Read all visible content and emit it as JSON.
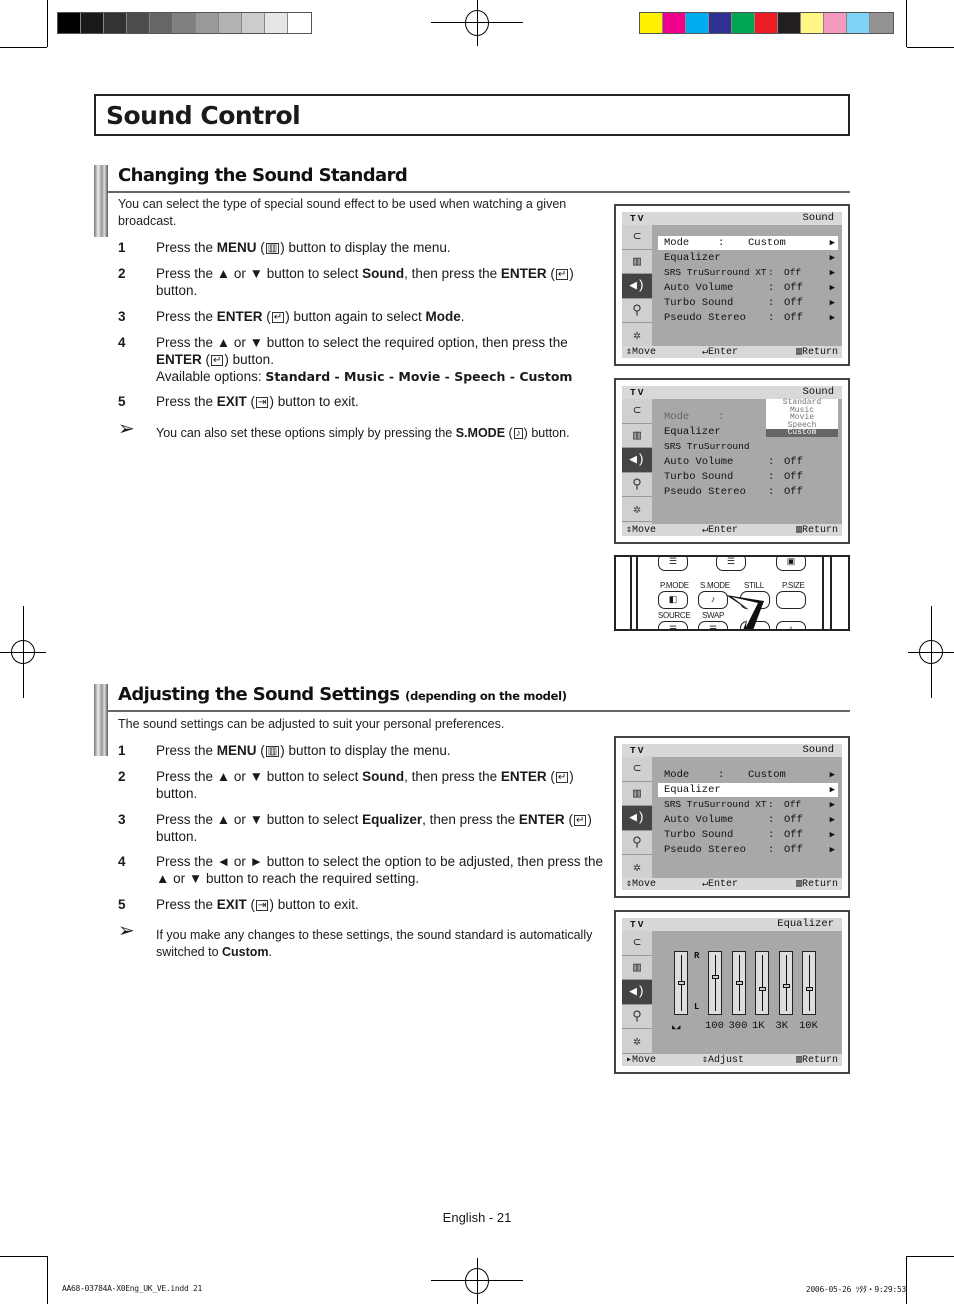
{
  "print_marks": {
    "gray_swatches": [
      "#000000",
      "#1a1a1a",
      "#333333",
      "#4d4d4d",
      "#666666",
      "#808080",
      "#999999",
      "#b3b3b3",
      "#cccccc",
      "#e6e6e6",
      "#ffffff"
    ],
    "color_swatches": [
      "#fff200",
      "#ec008c",
      "#00aeef",
      "#2e3192",
      "#00a651",
      "#ed1c24",
      "#231f20",
      "#fff685",
      "#f49ac1",
      "#7fd3f7",
      "#939393"
    ]
  },
  "page_title": "Sound Control",
  "section1": {
    "heading": "Changing the Sound Standard",
    "intro": "You can select the type of special sound effect to be used when watching a given broadcast.",
    "steps": [
      {
        "num": "1",
        "pre": "Press the ",
        "b1": "MENU",
        "icon": "▥",
        "post": " button to display the menu."
      },
      {
        "num": "2",
        "pre": "Press the ▲ or ▼ button to select ",
        "b1": "Sound",
        "mid": ", then press the ",
        "b2": "ENTER",
        "icon": "↵",
        "post": " button."
      },
      {
        "num": "3",
        "pre": "Press the ",
        "b1": "ENTER",
        "icon": "↵",
        "mid": " button again to select ",
        "b2": "Mode",
        "post": "."
      },
      {
        "num": "4",
        "pre": "Press the ▲ or ▼ button to select the required option, then press the ",
        "b1": "ENTER",
        "icon": "↵",
        "post": " button.",
        "line2_pre": "Available options: ",
        "line2_bold": "Standard - Music - Movie - Speech - Custom"
      },
      {
        "num": "5",
        "pre": "Press the ",
        "b1": "EXIT",
        "icon": "⇥",
        "post": " button to exit."
      }
    ],
    "note": {
      "pre": "You can also set these options simply by pressing the ",
      "bold": "S.MODE",
      "icon": "♪",
      "post": " button."
    }
  },
  "section2": {
    "heading": "Adjusting the Sound Settings",
    "heading_suffix": "(depending on the model)",
    "intro": "The sound settings can be adjusted to suit your personal preferences.",
    "steps": [
      {
        "num": "1",
        "pre": "Press the ",
        "b1": "MENU",
        "icon": "▥",
        "post": " button to display the menu."
      },
      {
        "num": "2",
        "pre": "Press the ▲ or ▼ button to select ",
        "b1": "Sound",
        "mid": ", then press the ",
        "b2": "ENTER",
        "icon": "↵",
        "post": " button."
      },
      {
        "num": "3",
        "pre": "Press the ▲ or ▼ button to select ",
        "b1": "Equalizer",
        "mid": ", then press the ",
        "b2": "ENTER",
        "icon": "↵",
        "post": " button."
      },
      {
        "num": "4",
        "text": "Press the ◄ or ► button to select the option to be adjusted, then press the ▲ or ▼ button to reach the required setting."
      },
      {
        "num": "5",
        "pre": "Press the ",
        "b1": "EXIT",
        "icon": "⇥",
        "post": " button to exit."
      }
    ],
    "note": {
      "pre": "If you make any changes to these settings, the sound standard is automatically switched to ",
      "bold": "Custom",
      "post": "."
    }
  },
  "osd": {
    "tv_label": "TV",
    "sound_title": "Sound",
    "eq_title": "Equalizer",
    "side_icons": [
      "input-icon",
      "picture-icon",
      "sound-icon",
      "channel-icon",
      "setup-icon"
    ],
    "rows": [
      {
        "label": "Mode",
        "sep": ":",
        "value": "Custom"
      },
      {
        "label": "Equalizer",
        "value": ""
      },
      {
        "label": "SRS TruSurround XT",
        "sep": ":",
        "value": "Off"
      },
      {
        "label": "Auto Volume",
        "sep": ":",
        "value": "Off"
      },
      {
        "label": "Turbo Sound",
        "sep": ":",
        "value": "Off"
      },
      {
        "label": "Pseudo Stereo",
        "sep": ":",
        "value": "Off"
      }
    ],
    "srs_short": "SRS TruSurround",
    "mode_options": [
      "Standard",
      "Music",
      "Movie",
      "Speech",
      "Custom"
    ],
    "mode_selected": "Custom",
    "footer": {
      "move": "Move",
      "enter": "Enter",
      "return": "Return",
      "adjust": "Adjust"
    },
    "eq": {
      "balance_labels": {
        "top": "R",
        "bottom": "L"
      },
      "bands": [
        {
          "label": "100",
          "level": 0.38
        },
        {
          "label": "300",
          "level": 0.5
        },
        {
          "label": "1K",
          "level": 0.62
        },
        {
          "label": "3K",
          "level": 0.55
        },
        {
          "label": "10K",
          "level": 0.62
        }
      ],
      "balance_level": 0.5
    }
  },
  "remote": {
    "labels": [
      "P.MODE",
      "S.MODE",
      "STILL",
      "P.SIZE",
      "SOURCE",
      "SWAP"
    ]
  },
  "footer": {
    "page_label": "English - 21",
    "slug_left": "AA68-03784A-X0Eng_UK_VE.indd   21",
    "slug_right": "2006-05-26   ｿﾀﾀ・9:29:53"
  }
}
